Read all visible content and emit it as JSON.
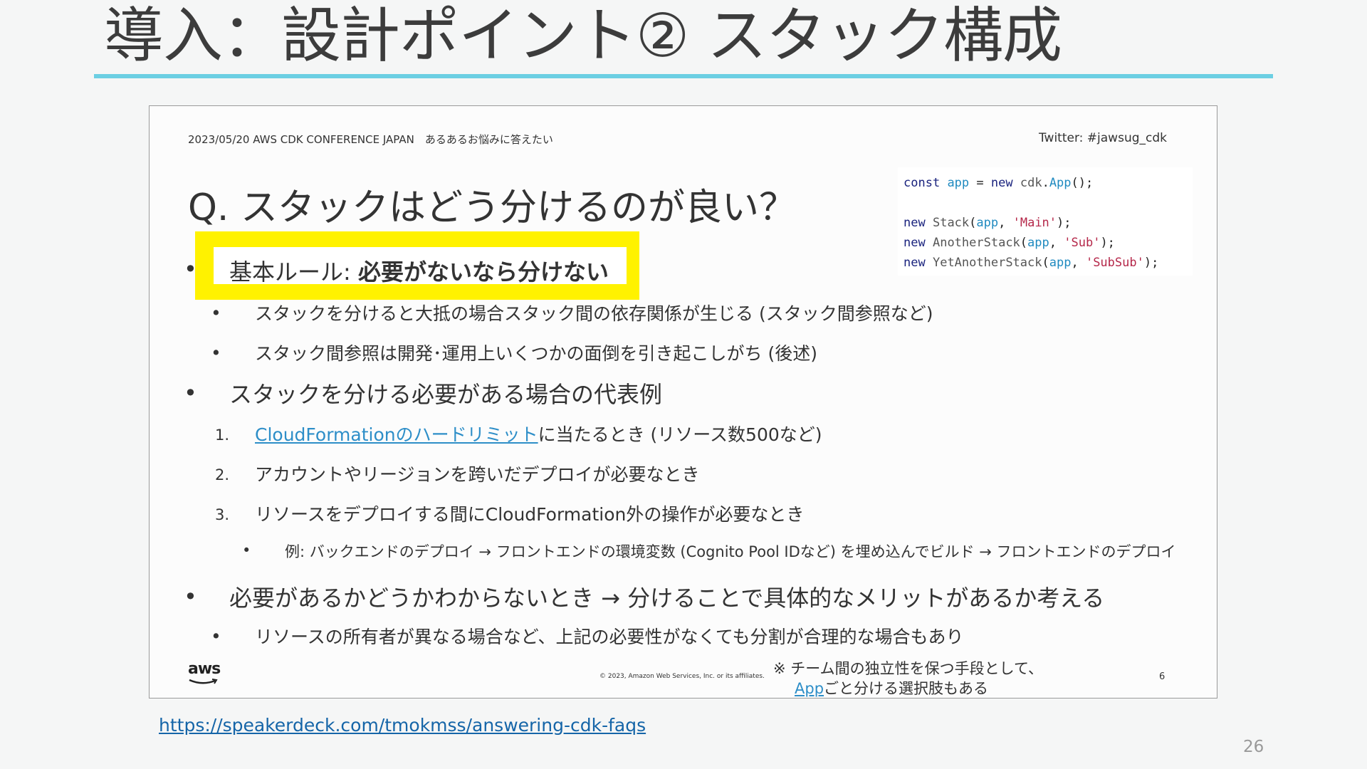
{
  "slide": {
    "title": "導入：設計ポイント② スタック構成",
    "url": "https://speakerdeck.com/tmokmss/answering-cdk-faqs",
    "page_number": "26"
  },
  "embed": {
    "header_left": "2023/05/20 AWS CDK CONFERENCE JAPAN　あるあるお悩みに答えたい",
    "header_right": "Twitter: #jawsug_cdk",
    "question": "Q. スタックはどう分けるのが良い？",
    "code_lines": [
      "const app = new cdk.App();",
      "",
      "new Stack(app, 'Main');",
      "new AnotherStack(app, 'Sub');",
      "new YetAnotherStack(app, 'SubSub');"
    ],
    "rule_label": "基本ルール: ",
    "rule_strong": "必要がないなら分けない",
    "sub1": "スタックを分けると大抵の場合スタック間の依存関係が生じる (スタック間参照など)",
    "sub2": "スタック間参照は開発･運用上いくつかの面倒を引き起こしがち (後述)",
    "bullet2": "スタックを分ける必要がある場合の代表例",
    "num1": "1.",
    "item1_link": "CloudFormationのハードリミット",
    "item1_rest": "に当たるとき (リソース数500など)",
    "num2": "2.",
    "item2": "アカウントやリージョンを跨いだデプロイが必要なとき",
    "num3": "3.",
    "item3": "リソースをデプロイする間にCloudFormation外の操作が必要なとき",
    "example": "例: バックエンドのデプロイ → フロントエンドの環境変数 (Cognito Pool IDなど) を埋め込んでビルド → フロントエンドのデプロイ",
    "bullet3": "必要があるかどうかわからないとき → 分けることで具体的なメリットがあるか考える",
    "sub3": "リソースの所有者が異なる場合など、上記の必要性がなくても分割が合理的な場合もあり",
    "aws_logo_text": "aws",
    "copyright": "© 2023, Amazon Web Services, Inc. or its affiliates.",
    "note_line1": "※ チーム間の独立性を保つ手段として、",
    "note_link": "App",
    "note_rest": "ごと分ける選択肢もある",
    "inner_page": "6",
    "bullet_char": "•"
  },
  "colors": {
    "accent_rule": "#6ccfe3",
    "highlight": "#fff200",
    "link": "#2d8ec8"
  }
}
